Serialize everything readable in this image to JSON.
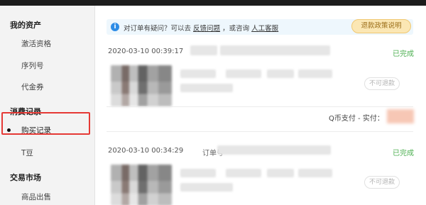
{
  "sidebar": {
    "groups": [
      {
        "title": "我的资产",
        "items": [
          "激活资格",
          "序列号",
          "代金券"
        ]
      },
      {
        "title": "消费记录",
        "items": [
          "购买记录",
          "T豆"
        ]
      },
      {
        "title": "交易市场",
        "items": [
          "商品出售"
        ]
      }
    ],
    "active_item": "购买记录"
  },
  "notice": {
    "prefix": "对订单有疑问？可以去",
    "feedback_link": "反馈问题",
    "middle": "，或咨询",
    "service_link": "人工客服"
  },
  "refund_policy_button": "退款政策说明",
  "orders": [
    {
      "time": "2020-03-10 00:39:17",
      "status": "已完成",
      "refund_button": "不可退款",
      "payment_label": "Q币支付 - 实付："
    },
    {
      "time": "2020-03-10 00:34:29",
      "order_no_label": "订单号",
      "status": "已完成",
      "refund_button": "不可退款"
    }
  ],
  "colors": {
    "status_green": "#4caf50",
    "highlight_red": "#e53935",
    "info_blue": "#2d8ce6",
    "policy_bg": "#fbe7b4"
  }
}
